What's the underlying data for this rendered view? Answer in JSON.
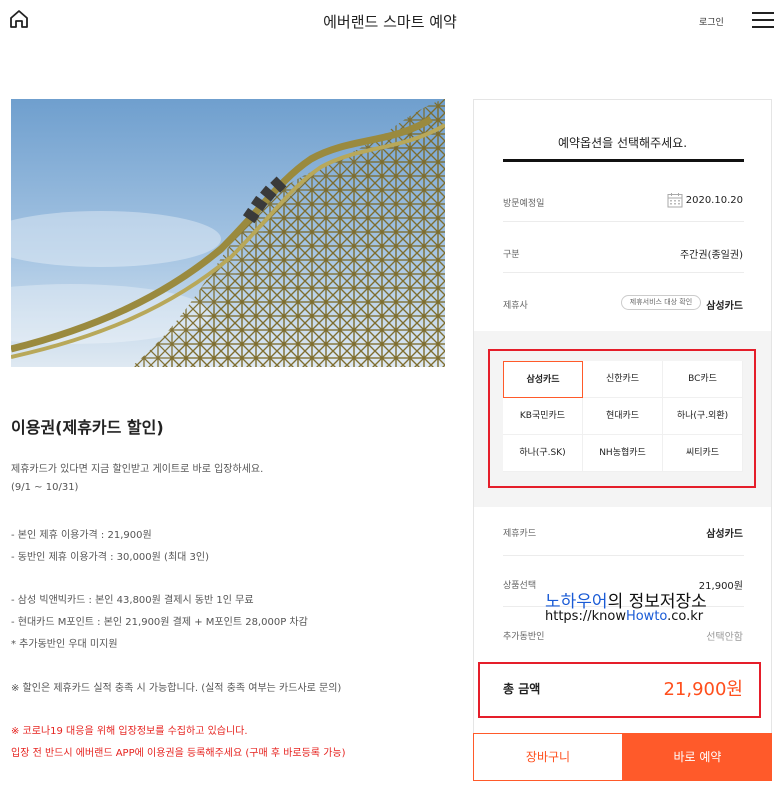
{
  "header": {
    "title": "에버랜드 스마트 예약",
    "login_label": "로그인",
    "home_icon": "home-icon",
    "menu_icon": "hamburger-menu-icon"
  },
  "product": {
    "title": "이용권(제휴카드 할인)",
    "lines": [
      "제휴카드가 있다면 지금 할인받고 게이트로 바로 입장하세요.",
      "(9/1 ~ 10/31)",
      "- 본인 제휴 이용가격 : 21,900원",
      "- 동반인 제휴 이용가격 : 30,000원 (최대 3인)",
      "- 삼성 빅앤빅카드 : 본인 43,800원 결제시 동반 1인 무료",
      "- 현대카드 M포인트 : 본인 21,900원 결제 + M포인트 28,000P 차감",
      "* 추가동반인 우대 미지원",
      "※ 할인은 제휴카드 실적 충족 시 가능합니다. (실적 충족 여부는 카드사로 문의)"
    ],
    "notice_lines": [
      "※ 코로나19 대응을 위해 입장정보를 수집하고 있습니다.",
      "입장 전 반드시 에버랜드 APP에 이용권을 등록해주세요 (구매 후 바로등록 가능)"
    ]
  },
  "booking": {
    "heading": "예약옵션을 선택해주세요.",
    "visit_date_label": "방문예정일",
    "visit_date_value": "2020.10.20",
    "type_label": "구분",
    "type_value": "주간권(종일권)",
    "partner_label": "제휴사",
    "partner_badge": "제휴서비스 대상 확인",
    "partner_value": "삼성카드",
    "cards": [
      "삼성카드",
      "신한카드",
      "BC카드",
      "KB국민카드",
      "현대카드",
      "하나(구.외환)",
      "하나(구.SK)",
      "NH농협카드",
      "씨티카드"
    ],
    "selected_card": "삼성카드",
    "partner_card_label": "제휴카드",
    "partner_card_value": "삼성카드",
    "product_select_label": "상품선택",
    "product_select_value": "21,900원",
    "companion_label": "추가동반인",
    "companion_value": "선택안함",
    "total_label": "총 금액",
    "total_value": "21,900원",
    "cart_label": "장바구니",
    "book_label": "바로 예약",
    "accent_color": "#ff5a2a",
    "highlight_color": "#e51e2a"
  },
  "watermark": {
    "line1_blue": "노하우어",
    "line1_rest": "의 정보저장소",
    "line2_prefix": "https://know",
    "line2_blue": "Howto",
    "line2_suffix": ".co.kr"
  }
}
